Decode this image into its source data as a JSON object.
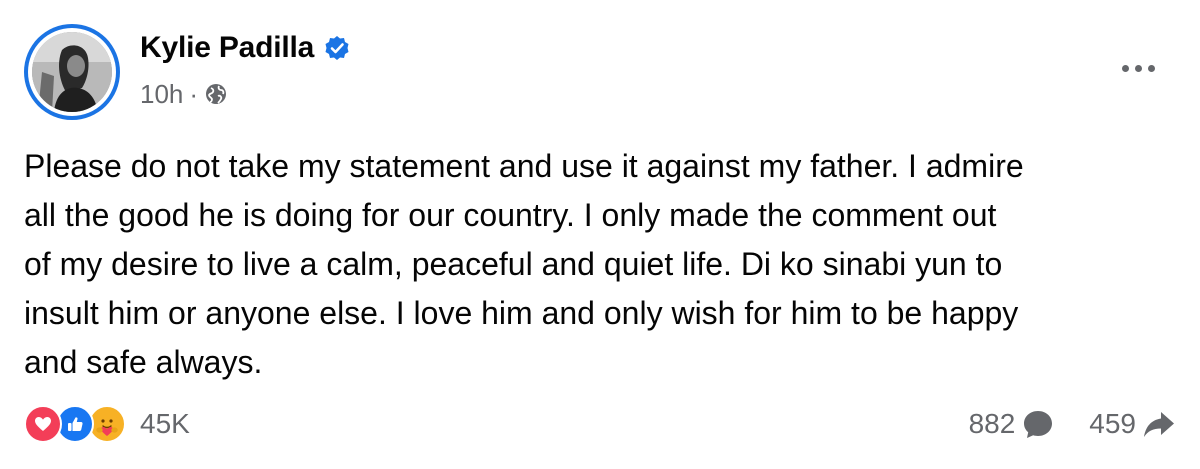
{
  "post": {
    "author": "Kylie Padilla",
    "time": "10h",
    "separator": "·",
    "privacy_icon": "globe-icon",
    "verified_icon": "verified-badge-icon",
    "text_lines": [
      "Please do not take my statement and use it against my father. I admire",
      "all the good he is doing for our country. I only made the comment out",
      "of my desire to live a calm, peaceful and quiet life. Di ko sinabi yun to",
      "insult him or anyone else. I love him and only wish for him to be happy",
      "and safe always."
    ]
  },
  "footer": {
    "reaction_icons": [
      "love-reaction-icon",
      "like-reaction-icon",
      "care-reaction-icon"
    ],
    "reaction_count": "45K",
    "comment_count": "882",
    "share_count": "459"
  },
  "colors": {
    "accent": "#1b74e4",
    "secondary_text": "#65676b",
    "love": "#f33e58",
    "like": "#1877f2",
    "care": "#f7b125"
  }
}
